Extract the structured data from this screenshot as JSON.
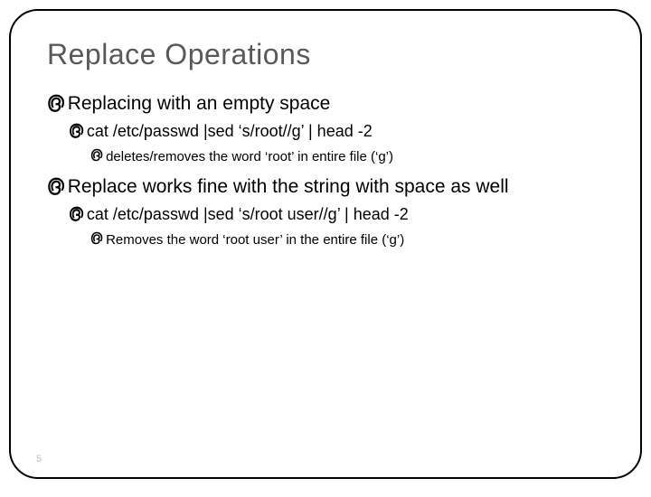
{
  "title": "Replace Operations",
  "bullets": {
    "b1": "Replacing with an empty space",
    "b1_1": "cat /etc/passwd |sed ‘s/root//g’ | head -2",
    "b1_1_1": "deletes/removes the word ‘root’ in entire file (‘g’)",
    "b2": "Replace works fine with the string with space as well",
    "b2_1": "cat /etc/passwd |sed ‘s/root user//g’ | head -2",
    "b2_1_1": "Removes the word ‘root user’ in the entire file (‘g’)"
  },
  "glyph": "൫",
  "page": "5"
}
